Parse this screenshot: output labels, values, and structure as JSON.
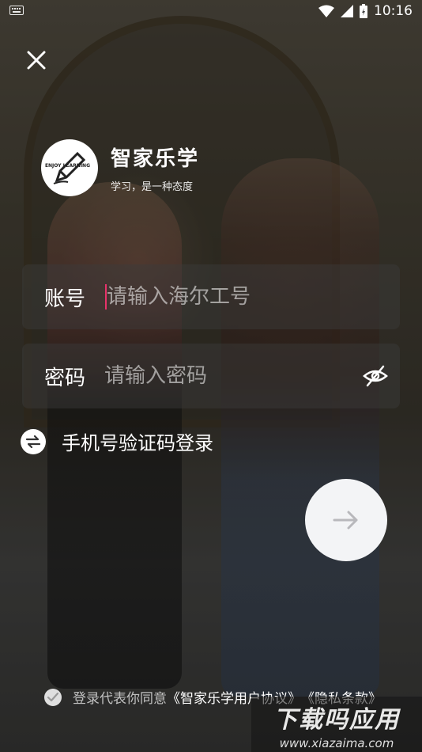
{
  "status_bar": {
    "time": "10:16",
    "left_icon": "keyboard-icon"
  },
  "brand": {
    "name": "智家乐学",
    "slogan": "学习，是一种态度",
    "logo_text": "ENJOY LEARNING"
  },
  "account": {
    "label": "账号",
    "placeholder": "请输入海尔工号"
  },
  "password": {
    "label": "密码",
    "placeholder": "请输入密码"
  },
  "alt_login": {
    "label": "手机号验证码登录"
  },
  "agreement": {
    "prefix": "登录代表你同意",
    "user_agreement": "《智家乐学用户协议》",
    "privacy": "《隐私条款》"
  },
  "watermark": {
    "title": "下载吗应用",
    "url": "www.xiazaima.com"
  },
  "colors": {
    "caret": "#e8336a",
    "submit_bg": "#f3f4f6"
  }
}
